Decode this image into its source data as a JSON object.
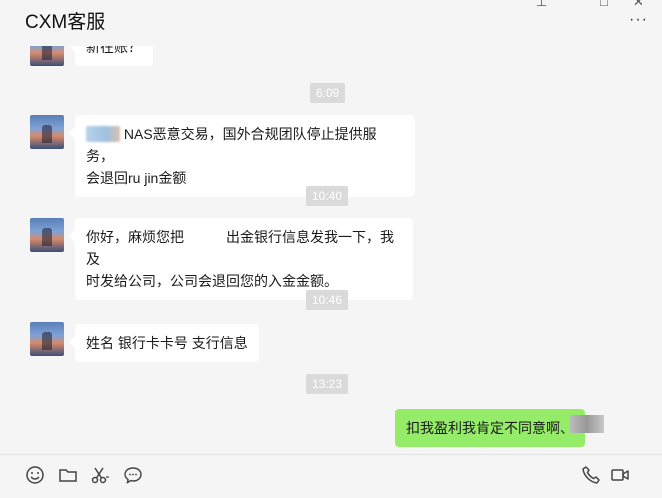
{
  "window": {
    "title": "CXM客服"
  },
  "messages": [
    {
      "type": "received",
      "text": "新在账？"
    },
    {
      "type": "time",
      "text": "6:09"
    },
    {
      "type": "received",
      "line1": "NAS恶意交易，国外合规团队停止提供服务，",
      "line2": "会退回ru jin金额"
    },
    {
      "type": "time",
      "text": "10:40"
    },
    {
      "type": "received",
      "line1a": "你好，麻烦您把",
      "line1b": "出金银行信息发我一下，我及",
      "line2": "时发给公司，公司会退回您的入金金额。"
    },
    {
      "type": "time",
      "text": "10:46"
    },
    {
      "type": "received",
      "text": "姓名 银行卡卡号 支行信息"
    },
    {
      "type": "time",
      "text": "13:23"
    },
    {
      "type": "sent",
      "text": "扣我盈利我肯定不同意啊、"
    }
  ],
  "toolbar": {
    "icons": [
      "emoji-icon",
      "folder-icon",
      "scissors-icon",
      "chat-bubble-icon",
      "phone-icon",
      "video-icon"
    ]
  }
}
